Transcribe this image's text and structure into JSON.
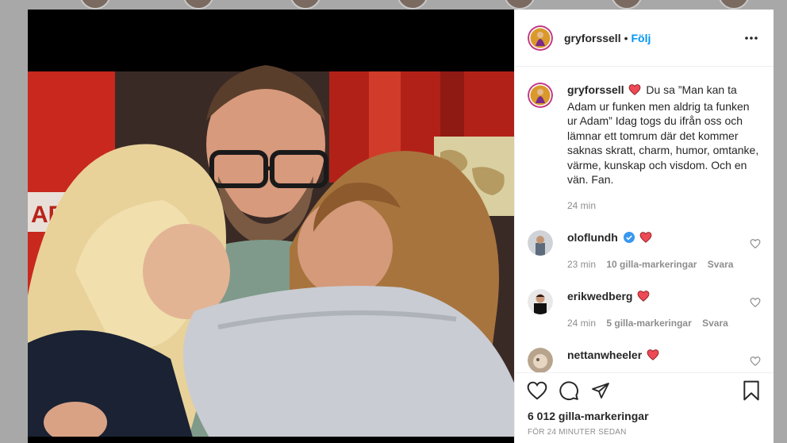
{
  "post": {
    "username": "gryforssell",
    "follow_label": "Följ",
    "separator": "•",
    "caption_text": "Du sa ”Man kan ta Adam ur funken men aldrig ta funken ur Adam” Idag togs du ifrån oss och lämnar ett tomrum där det kommer saknas skratt, charm, humor, omtanke, värme, kunskap och visdom. Och en vän. Fan.",
    "caption_time": "24 min",
    "likes_label": "6 012 gilla-markeringar",
    "posted_ago": "FÖR 24 MINUTER SEDAN"
  },
  "comments": [
    {
      "username": "oloflundh",
      "verified": true,
      "time": "23 min",
      "likes": "10 gilla-markeringar",
      "reply": "Svara"
    },
    {
      "username": "erikwedberg",
      "verified": false,
      "time": "24 min",
      "likes": "5 gilla-markeringar",
      "reply": "Svara"
    },
    {
      "username": "nettanwheeler",
      "verified": false,
      "time": "",
      "likes": "",
      "reply": ""
    }
  ],
  "icons": {
    "more": "more-options-icon",
    "like": "heart-icon",
    "comment": "comment-icon",
    "share": "share-icon",
    "save": "bookmark-icon"
  },
  "colors": {
    "accent": "#0095f6",
    "heart": "#ed4956",
    "verified": "#3897f0",
    "muted": "#8e8e8e"
  }
}
